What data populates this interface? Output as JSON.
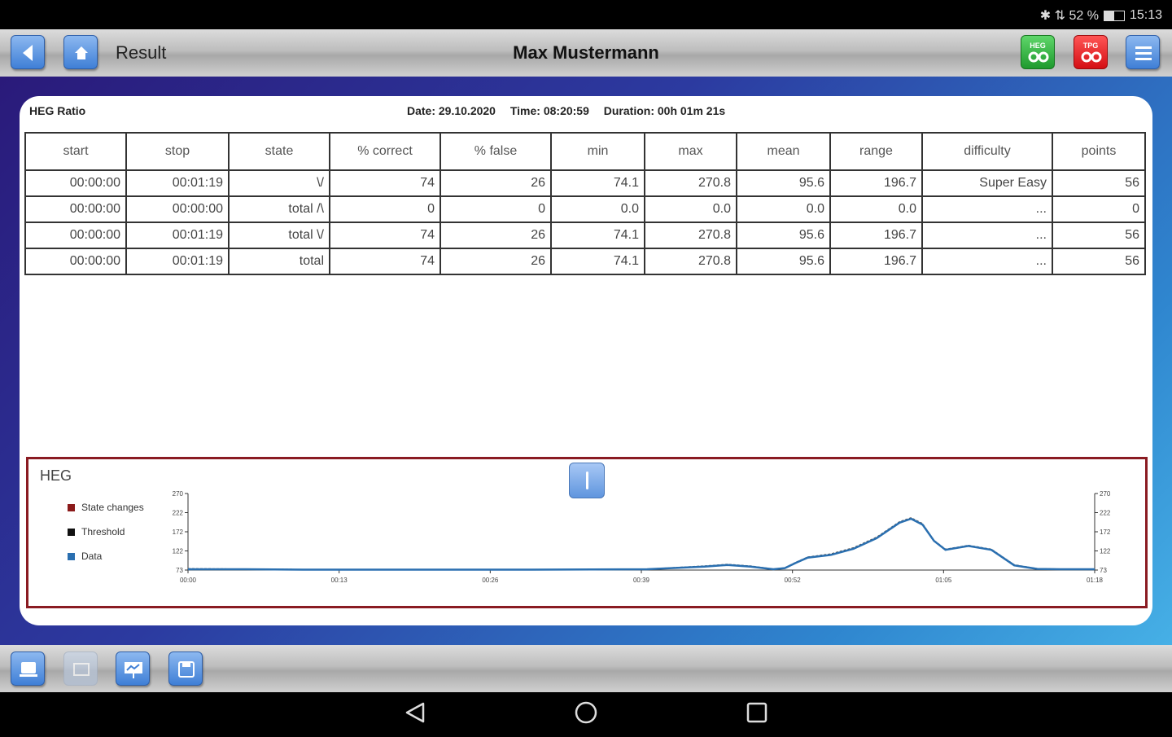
{
  "statusbar": {
    "signal": "✱ ⇅ 52 %",
    "time": "15:13",
    "battery_level": 0.52
  },
  "topbar": {
    "title": "Result",
    "user_name": "Max Mustermann",
    "heg_button_label": "HEG",
    "tpg_button_label": "TPG"
  },
  "result": {
    "title": "HEG Ratio",
    "date": "Date: 29.10.2020",
    "time": "Time: 08:20:59",
    "duration": "Duration: 00h 01m 21s"
  },
  "table": {
    "columns": [
      "start",
      "stop",
      "state",
      "% correct",
      "% false",
      "min",
      "max",
      "mean",
      "range",
      "difficulty",
      "points"
    ],
    "rows": [
      [
        "00:00:00",
        "00:01:19",
        "\\/",
        "74",
        "26",
        "74.1",
        "270.8",
        "95.6",
        "196.7",
        "Super Easy",
        "56"
      ],
      [
        "00:00:00",
        "00:00:00",
        "total /\\",
        "0",
        "0",
        "0.0",
        "0.0",
        "0.0",
        "0.0",
        "...",
        "0"
      ],
      [
        "00:00:00",
        "00:01:19",
        "total \\/",
        "74",
        "26",
        "74.1",
        "270.8",
        "95.6",
        "196.7",
        "...",
        "56"
      ],
      [
        "00:00:00",
        "00:01:19",
        "total",
        "74",
        "26",
        "74.1",
        "270.8",
        "95.6",
        "196.7",
        "...",
        "56"
      ]
    ]
  },
  "chart_data": {
    "type": "line",
    "title": "HEG",
    "legend": [
      {
        "label": "State changes",
        "color": "#8b1a1a"
      },
      {
        "label": "Threshold",
        "color": "#111111"
      },
      {
        "label": "Data",
        "color": "#2a6fb0"
      }
    ],
    "legend_position": "left",
    "x_ticks": [
      "00:00",
      "00:13",
      "00:26",
      "00:39",
      "00:52",
      "01:05",
      "01:18"
    ],
    "x_range": [
      0,
      79
    ],
    "y_ticks_left": [
      "270",
      "222",
      "172",
      "122",
      "73"
    ],
    "y_ticks_right": [
      "270",
      "222",
      "172",
      "122",
      "73"
    ],
    "ylim": [
      73,
      270
    ],
    "series": [
      {
        "name": "Data",
        "x": [
          0,
          5,
          10,
          20,
          30,
          40,
          45,
          47,
          49,
          51,
          52,
          53,
          54,
          56,
          58,
          60,
          61,
          62,
          63,
          64,
          65,
          66,
          68,
          70,
          72,
          74,
          76,
          79
        ],
        "y": [
          75,
          75,
          74,
          74,
          74,
          75,
          82,
          86,
          82,
          75,
          78,
          92,
          105,
          112,
          128,
          155,
          175,
          195,
          205,
          190,
          148,
          125,
          135,
          125,
          85,
          76,
          75,
          75
        ]
      },
      {
        "name": "Threshold",
        "x": [
          0,
          5,
          10,
          20,
          30,
          40,
          45,
          47,
          49,
          51,
          52,
          53,
          54,
          56,
          58,
          60,
          61,
          62,
          63,
          64,
          65,
          66,
          68,
          70,
          72,
          74,
          76,
          79
        ],
        "y": [
          77,
          76,
          75,
          74,
          74,
          76,
          84,
          88,
          84,
          76,
          79,
          94,
          107,
          115,
          131,
          158,
          178,
          198,
          208,
          193,
          150,
          127,
          137,
          127,
          87,
          77,
          76,
          76
        ]
      }
    ],
    "grid": false
  },
  "bottombar": {
    "buttons": [
      "report-icon",
      "chart-disabled-icon",
      "presentation-icon",
      "save-icon"
    ]
  },
  "navbar": {
    "back": "back-icon",
    "home": "home-circle-icon",
    "recents": "recents-icon"
  }
}
